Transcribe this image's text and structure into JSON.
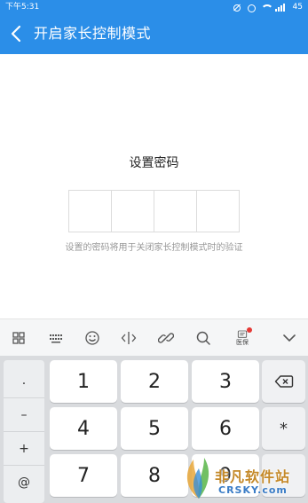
{
  "status_bar": {
    "time": "下午5:31",
    "battery": "45"
  },
  "header": {
    "title": "开启家长控制模式",
    "back_icon": "chevron-left-icon"
  },
  "main": {
    "password_title": "设置密码",
    "password_box_count": 4,
    "hint": "设置的密码将用于关闭家长控制模式时的验证"
  },
  "keyboard_toolbar": {
    "items": [
      {
        "icon": "grid-icon"
      },
      {
        "icon": "keyboard-icon"
      },
      {
        "icon": "emoji-icon"
      },
      {
        "icon": "cursor-move-icon"
      },
      {
        "icon": "link-icon"
      },
      {
        "icon": "search-icon"
      },
      {
        "icon": "medical-insurance-icon",
        "label": "医保"
      },
      {
        "icon": "chevron-down-icon"
      }
    ]
  },
  "keyboard": {
    "side_keys": [
      ".",
      "–",
      "+",
      "@"
    ],
    "rows": [
      [
        "1",
        "2",
        "3"
      ],
      [
        "4",
        "5",
        "6"
      ],
      [
        "7",
        "8",
        "9"
      ]
    ],
    "right_keys": [
      "backspace-icon",
      "*",
      ""
    ]
  },
  "watermark": {
    "cn": "非凡软件站",
    "en": "CRSKY.com"
  },
  "colors": {
    "primary": "#2b8ee8",
    "keyboard_bg": "#d9dbde",
    "key_bg": "#ffffff",
    "hint_text": "#999999",
    "badge": "#e53935"
  }
}
